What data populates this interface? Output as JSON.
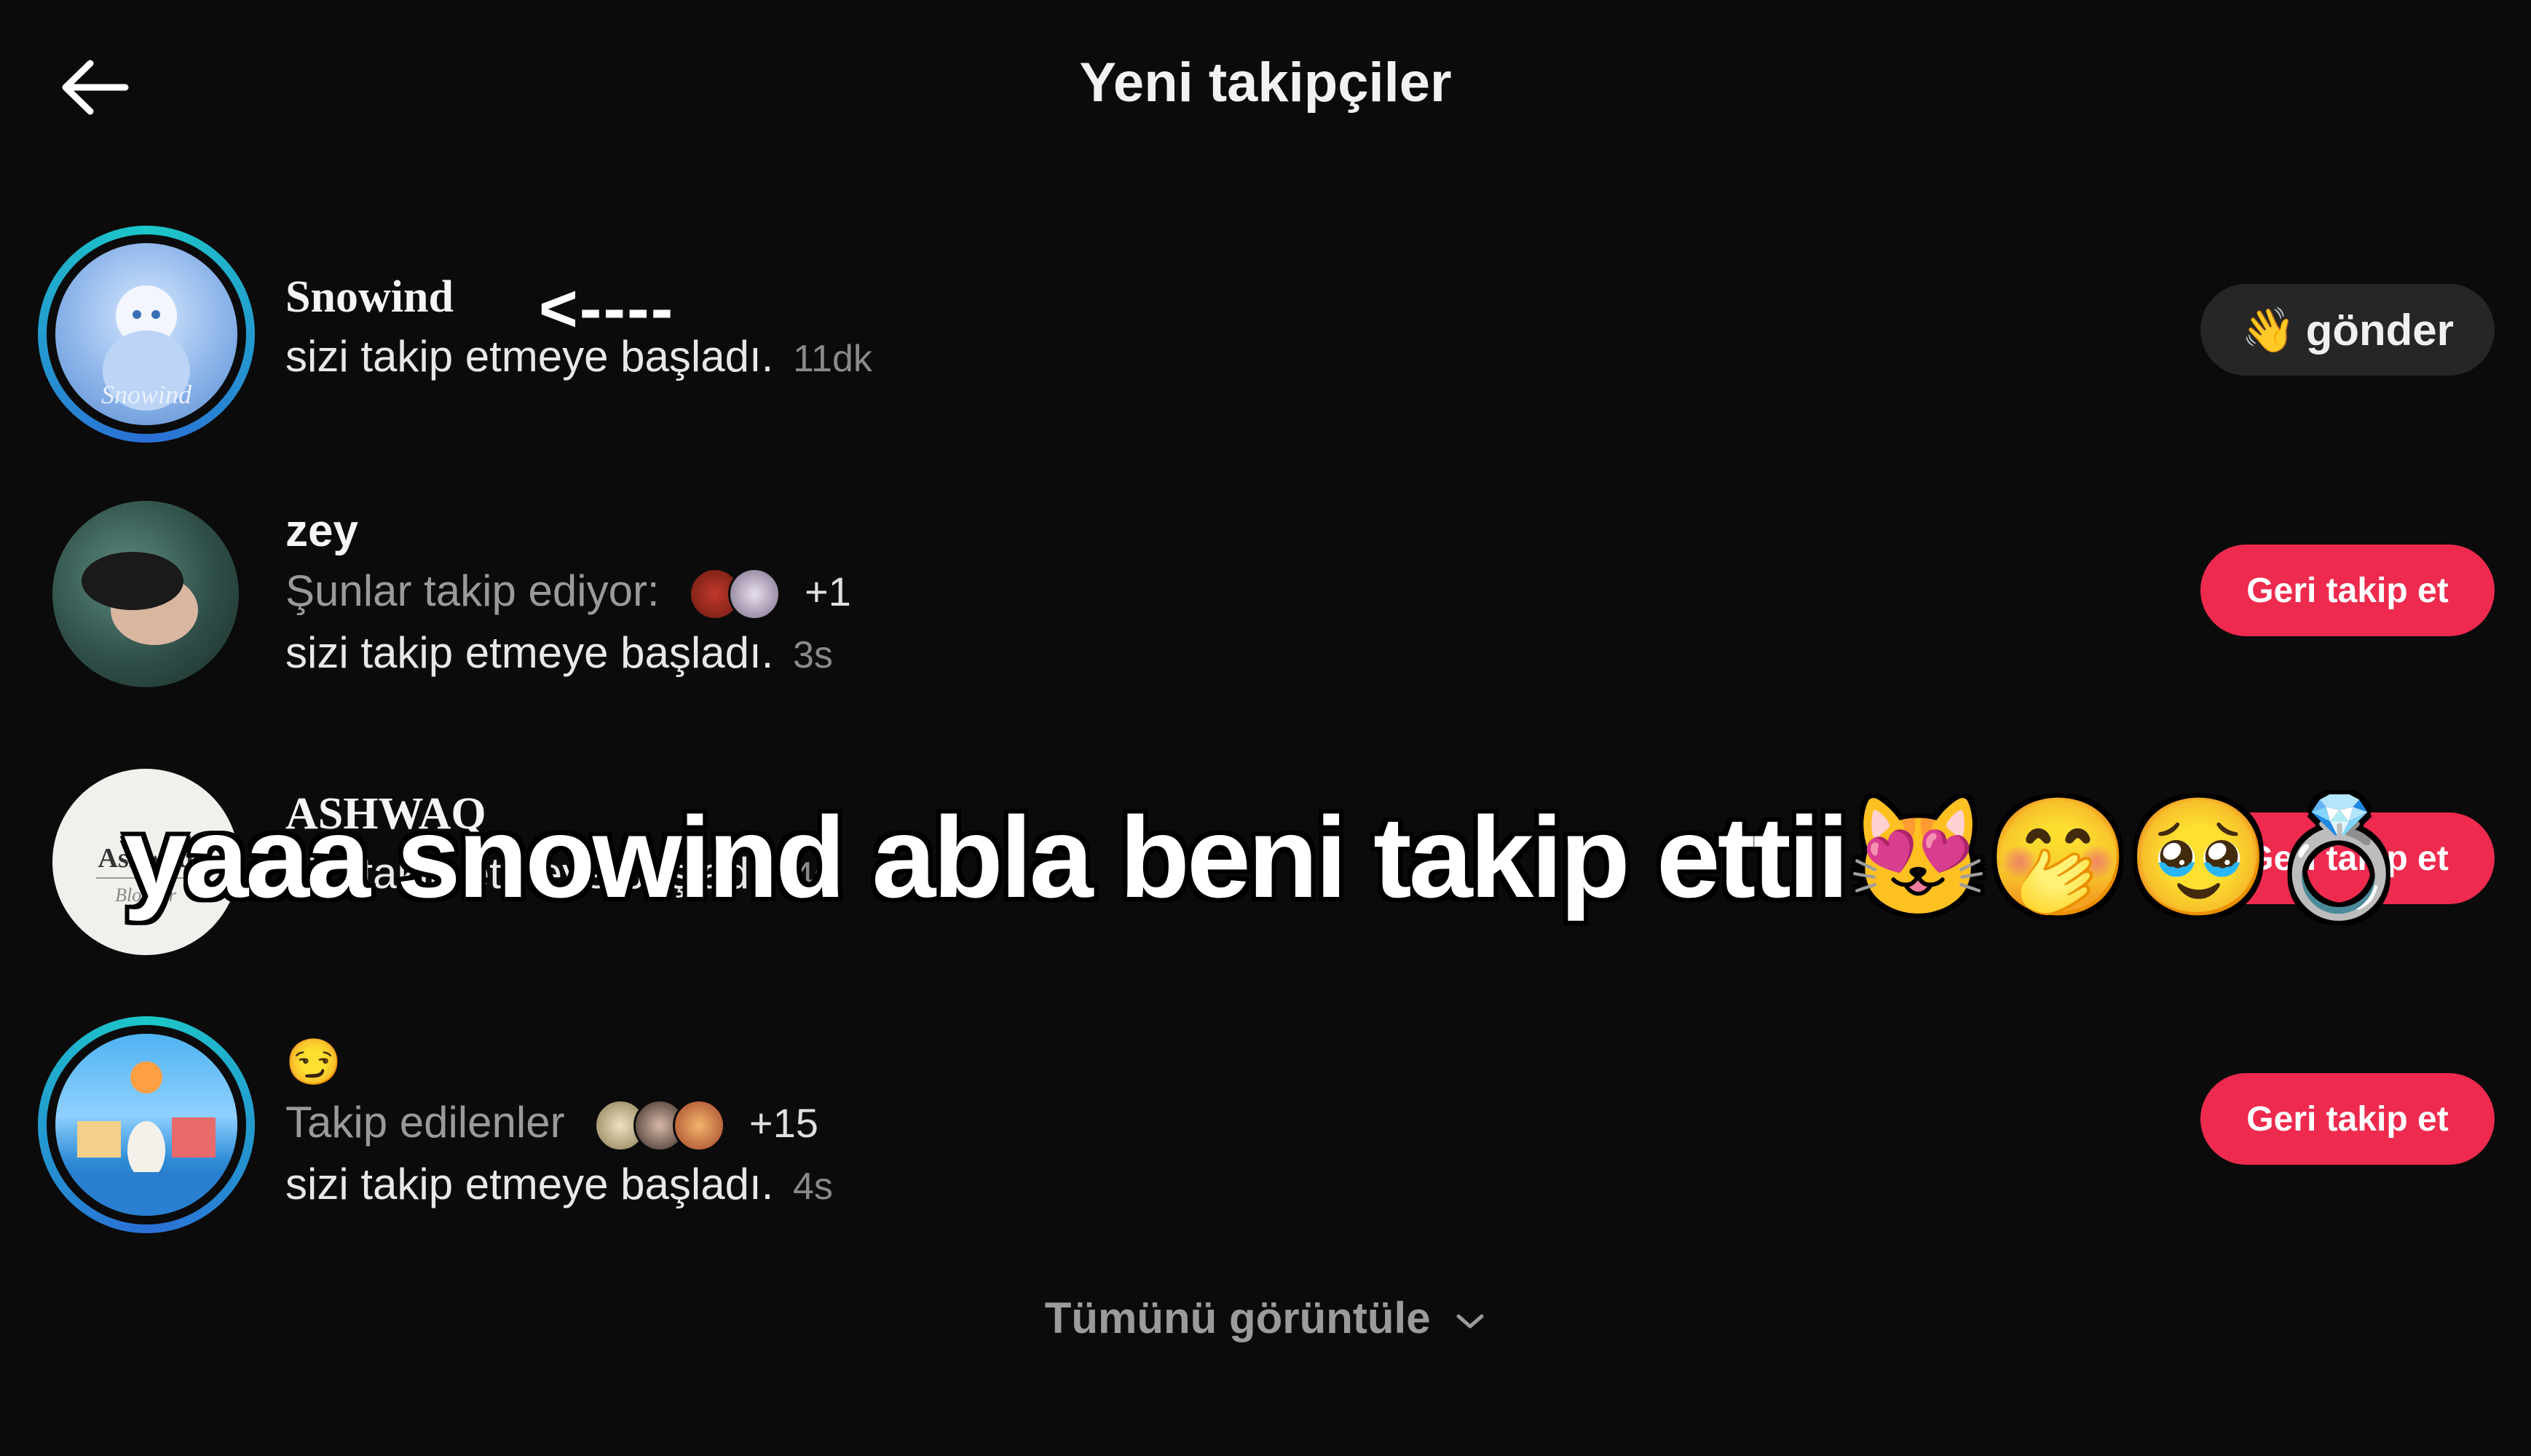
{
  "header": {
    "title": "Yeni takipçiler",
    "back_icon": "arrow-left-icon"
  },
  "followers": [
    {
      "username": "Snowind",
      "line1": "sizi takip etmeye başladı.",
      "time": "11dk",
      "button_label": "gönder",
      "button_emoji": "👋",
      "has_story_ring": true
    },
    {
      "username": "zey",
      "mutual_label": "Şunlar takip ediyor:",
      "mutual_extra": "+1",
      "line1": "sizi takip etmeye başladı.",
      "time": "3s",
      "button_label": "Geri takip et"
    },
    {
      "username": "ASHWAQ",
      "avatar_text": "Ashwaq",
      "avatar_subtext": "Blogger",
      "line1": "sizi takip etmeye başladı.",
      "time": "4s",
      "button_label": "Geri takip et"
    },
    {
      "username": "😏",
      "mutual_label": "Takip edilenler",
      "mutual_extra": "+15",
      "line1": "sizi takip etmeye başladı.",
      "time": "4s",
      "button_label": "Geri takip et",
      "has_story_ring": true
    }
  ],
  "annotation_arrow": "<----",
  "view_all": "Tümünü görüntüle",
  "overlay_caption": "yaaa snowind abla beni takip ettii😻🤭🥹💍",
  "colors": {
    "background": "#0b0b0b",
    "follow_back": "#ee2a4e",
    "dark_button": "#262626",
    "ring_start": "#1cc8c8",
    "ring_end": "#2b6fd6"
  }
}
